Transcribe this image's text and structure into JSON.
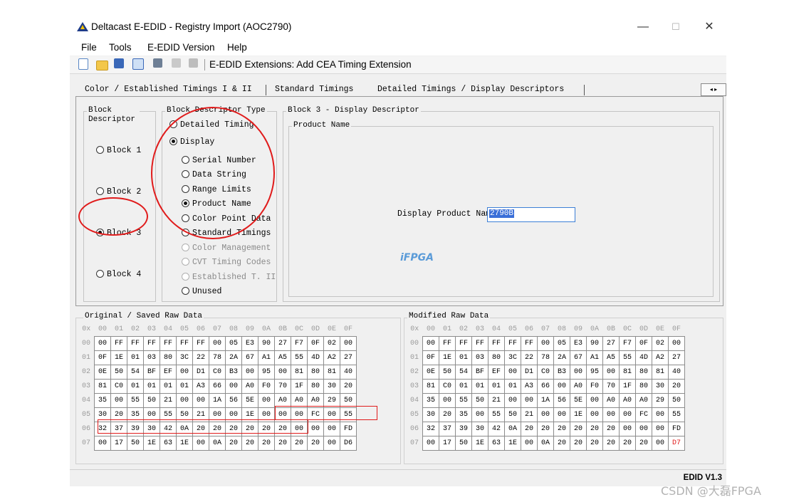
{
  "window": {
    "title": "Deltacast E-EDID - Registry Import (AOC2790)",
    "controls": [
      "—",
      "☐",
      "✕"
    ]
  },
  "menu": [
    "File",
    "Tools",
    "E-EDID Version",
    "Help"
  ],
  "toolbar": {
    "extensions_text": "E-EDID Extensions:  Add CEA Timing Extension"
  },
  "tabs": [
    "Color / Established Timings I & II",
    "Standard Timings",
    "Detailed Timings / Display Descriptors"
  ],
  "block_descriptor": {
    "title": "Block Descriptor",
    "blocks": [
      "Block 1",
      "Block 2",
      "Block 3",
      "Block 4"
    ],
    "selected": "Block 3"
  },
  "descriptor_type": {
    "title": "Block Descriptor Type",
    "detailed": "Detailed Timing",
    "display": "Display",
    "options": [
      "Serial Number",
      "Data String",
      "Range Limits",
      "Product Name",
      "Color Point Data",
      "Standard Timings",
      "Color Management",
      "CVT Timing Codes",
      "Established T. II",
      "Unused"
    ],
    "disabled": [
      "Color Management",
      "CVT Timing Codes",
      "Established T. II"
    ],
    "selected": "Product Name"
  },
  "block3": {
    "title": "Block 3 -  Display Descriptor",
    "product_group": "Product Name",
    "field_label": "Display Product Name:",
    "field_value": "2790B"
  },
  "watermark": {
    "text": "iFPGA",
    "color": "#5a9bd8"
  },
  "original": {
    "title": "Original / Saved Raw Data",
    "corner": "0x",
    "cols": [
      "00",
      "01",
      "02",
      "03",
      "04",
      "05",
      "06",
      "07",
      "08",
      "09",
      "0A",
      "0B",
      "0C",
      "0D",
      "0E",
      "0F"
    ],
    "rows": [
      {
        "label": "00",
        "cells": [
          "00",
          "FF",
          "FF",
          "FF",
          "FF",
          "FF",
          "FF",
          "00",
          "05",
          "E3",
          "90",
          "27",
          "F7",
          "0F",
          "02",
          "00"
        ]
      },
      {
        "label": "01",
        "cells": [
          "0F",
          "1E",
          "01",
          "03",
          "80",
          "3C",
          "22",
          "78",
          "2A",
          "67",
          "A1",
          "A5",
          "55",
          "4D",
          "A2",
          "27"
        ]
      },
      {
        "label": "02",
        "cells": [
          "0E",
          "50",
          "54",
          "BF",
          "EF",
          "00",
          "D1",
          "C0",
          "B3",
          "00",
          "95",
          "00",
          "81",
          "80",
          "81",
          "40"
        ]
      },
      {
        "label": "03",
        "cells": [
          "81",
          "C0",
          "01",
          "01",
          "01",
          "01",
          "A3",
          "66",
          "00",
          "A0",
          "F0",
          "70",
          "1F",
          "80",
          "30",
          "20"
        ]
      },
      {
        "label": "04",
        "cells": [
          "35",
          "00",
          "55",
          "50",
          "21",
          "00",
          "00",
          "1A",
          "56",
          "5E",
          "00",
          "A0",
          "A0",
          "A0",
          "29",
          "50"
        ]
      },
      {
        "label": "05",
        "cells": [
          "30",
          "20",
          "35",
          "00",
          "55",
          "50",
          "21",
          "00",
          "00",
          "1E",
          "00",
          "00",
          "00",
          "FC",
          "00",
          "55"
        ]
      },
      {
        "label": "06",
        "cells": [
          "32",
          "37",
          "39",
          "30",
          "42",
          "0A",
          "20",
          "20",
          "20",
          "20",
          "20",
          "20",
          "00",
          "00",
          "00",
          "FD"
        ]
      },
      {
        "label": "07",
        "cells": [
          "00",
          "17",
          "50",
          "1E",
          "63",
          "1E",
          "00",
          "0A",
          "20",
          "20",
          "20",
          "20",
          "20",
          "20",
          "00",
          "D6"
        ]
      }
    ]
  },
  "modified": {
    "title": "Modified Raw Data",
    "corner": "0x",
    "cols": [
      "00",
      "01",
      "02",
      "03",
      "04",
      "05",
      "06",
      "07",
      "08",
      "09",
      "0A",
      "0B",
      "0C",
      "0D",
      "0E",
      "0F"
    ],
    "rows": [
      {
        "label": "00",
        "cells": [
          "00",
          "FF",
          "FF",
          "FF",
          "FF",
          "FF",
          "FF",
          "00",
          "05",
          "E3",
          "90",
          "27",
          "F7",
          "0F",
          "02",
          "00"
        ]
      },
      {
        "label": "01",
        "cells": [
          "0F",
          "1E",
          "01",
          "03",
          "80",
          "3C",
          "22",
          "78",
          "2A",
          "67",
          "A1",
          "A5",
          "55",
          "4D",
          "A2",
          "27"
        ]
      },
      {
        "label": "02",
        "cells": [
          "0E",
          "50",
          "54",
          "BF",
          "EF",
          "00",
          "D1",
          "C0",
          "B3",
          "00",
          "95",
          "00",
          "81",
          "80",
          "81",
          "40"
        ]
      },
      {
        "label": "03",
        "cells": [
          "81",
          "C0",
          "01",
          "01",
          "01",
          "01",
          "A3",
          "66",
          "00",
          "A0",
          "F0",
          "70",
          "1F",
          "80",
          "30",
          "20"
        ]
      },
      {
        "label": "04",
        "cells": [
          "35",
          "00",
          "55",
          "50",
          "21",
          "00",
          "00",
          "1A",
          "56",
          "5E",
          "00",
          "A0",
          "A0",
          "A0",
          "29",
          "50"
        ]
      },
      {
        "label": "05",
        "cells": [
          "30",
          "20",
          "35",
          "00",
          "55",
          "50",
          "21",
          "00",
          "00",
          "1E",
          "00",
          "00",
          "00",
          "FC",
          "00",
          "55"
        ]
      },
      {
        "label": "06",
        "cells": [
          "32",
          "37",
          "39",
          "30",
          "42",
          "0A",
          "20",
          "20",
          "20",
          "20",
          "20",
          "20",
          "00",
          "00",
          "00",
          "FD"
        ]
      },
      {
        "label": "07",
        "cells": [
          "00",
          "17",
          "50",
          "1E",
          "63",
          "1E",
          "00",
          "0A",
          "20",
          "20",
          "20",
          "20",
          "20",
          "20",
          "00",
          "D7"
        ]
      }
    ],
    "changed_cell": {
      "row": "07",
      "col": "0F",
      "color": "#e01b1b"
    }
  },
  "status": {
    "version": "EDID V1.3"
  },
  "page_watermark": "CSDN @大磊FPGA",
  "colors": {
    "highlight": "#e01b1b",
    "selection": "#3a6fd8",
    "field_border": "#3c7fd6"
  }
}
